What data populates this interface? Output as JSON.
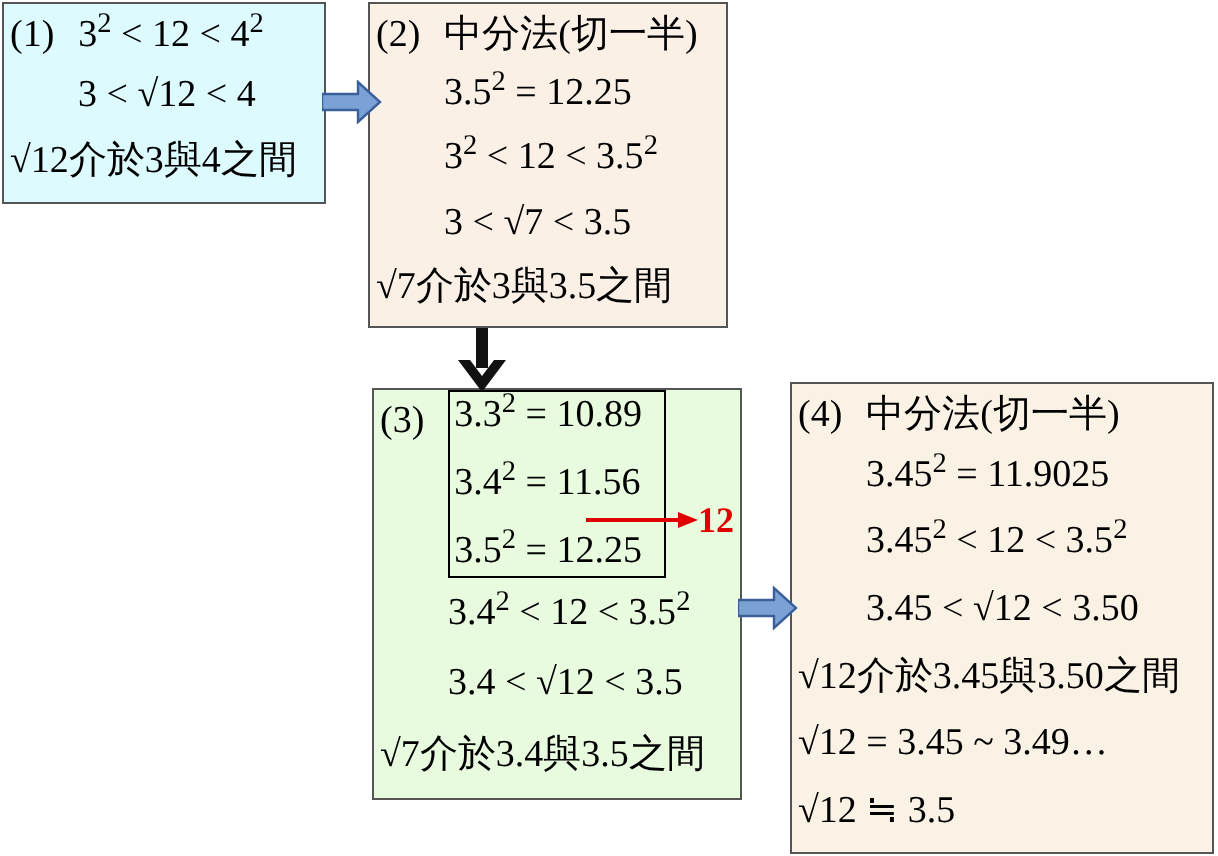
{
  "boxes": [
    {
      "label": "(1)",
      "title": "3$^{2}$ < 12 < 4$^{2}$",
      "color": "#ddfbff",
      "lines": [
        "3 < √12 < 4",
        "√12介於3與4之間"
      ]
    },
    {
      "label": "(2)",
      "title": "中分法(切一半)",
      "color": "#faf0e6",
      "lines": [
        "3.5$^{2}$ = 12.25",
        "3$^{2}$ < 12 < 3.5$^{2}$",
        "3 < √7 < 3.5",
        "√7介於3與3.5之間"
      ]
    },
    {
      "label": "(3)",
      "color": "#e8fbdf",
      "table_lines": [
        "3.3$^{2}$ = 10.89",
        "3.4$^{2}$ = 11.56",
        "3.5$^{2}$ = 12.25"
      ],
      "pointer_label": "12",
      "lines": [
        "3.4$^{2}$ < 12 < 3.5$^{2}$",
        "3.4 < √12 < 3.5",
        "√7介於3.4與3.5之間"
      ]
    },
    {
      "label": "(4)",
      "title": "中分法(切一半)",
      "color": "#fbf2e6",
      "lines": [
        "3.45$^{2}$ = 11.9025",
        "3.45$^{2}$ < 12 < 3.5$^{2}$",
        "3.45 < √12 < 3.50",
        "√12介於3.45與3.50之間",
        "√12 = 3.45 ~ 3.49…",
        "√12 ≒ 3.5"
      ]
    }
  ]
}
